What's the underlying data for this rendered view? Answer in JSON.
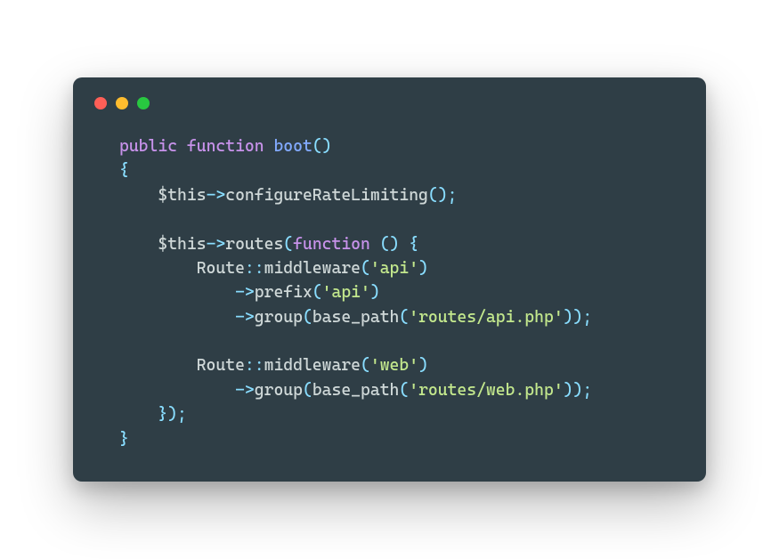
{
  "code": {
    "tokens": {
      "kw_public": "public",
      "kw_function": "function",
      "fn_boot": "boot",
      "paren_open": "(",
      "paren_close": ")",
      "brace_open": "{",
      "brace_close": "}",
      "semicolon": ";",
      "this": "$this",
      "arrow": "->",
      "m_configureRateLimiting": "configureRateLimiting",
      "m_routes": "routes",
      "kw_function2": "function",
      "Route": "Route",
      "dbl_colon": "::",
      "m_middleware": "middleware",
      "q": "'",
      "str_api": "api",
      "m_prefix": "prefix",
      "m_group": "group",
      "fn_base_path": "base_path",
      "str_routes_api": "routes/api.php",
      "str_web": "web",
      "str_routes_web": "routes/web.php",
      "close_routes": "})"
    }
  }
}
